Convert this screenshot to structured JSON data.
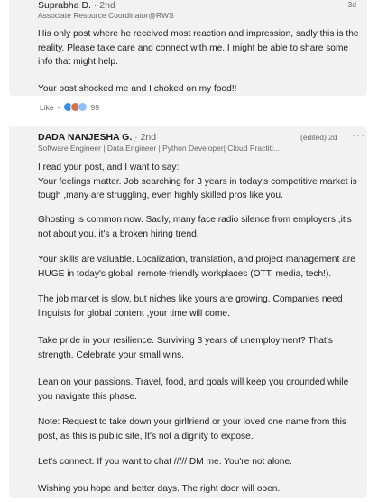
{
  "comment1": {
    "author": "Suprabha D.",
    "degree": "· 2nd",
    "subtitle": "Associate Resource Coordinator@RWS",
    "time": "3d",
    "paragraphs": [
      "His only post where he received most reaction and impression, sadly this is the reality. Please take care and connect with me. I might be able to share some info that might help.",
      "Your post shocked me and I choked on my food!!"
    ],
    "like_label": "Like",
    "reaction_count": "99"
  },
  "comment2": {
    "author": "DADA NANJESHA G.",
    "degree": "· 2nd",
    "subtitle": "Software Engineer | Data Engineer | Python Developer| Cloud Practiti...",
    "edited_time": "(edited) 2d",
    "more": "···",
    "paragraphs": [
      "I read your post, and I want to say:\nYour feelings matter. Job searching for 3 years in today's competitive market is tough ,many are struggling, even highly skilled pros like you.",
      "Ghosting is common now. Sadly, many face radio silence from employers ,it's not about you, it's a broken hiring trend.",
      "Your skills are valuable. Localization, translation, and project management are HUGE in today's global, remote-friendly workplaces (OTT, media, tech!).",
      "The job market is slow, but niches like yours are growing. Companies need linguists for global content ,your time will come.",
      "Take pride in your resilience. Surviving 3 years of unemployment? That's strength. Celebrate your small wins.",
      "Lean on your passions. Travel, food, and goals will keep you grounded while you navigate this phase.",
      "Note: Request to take down your girlfriend or your loved one name from this post, as this is public site, It's not a dignity to expose.",
      "Let's connect. If you want to chat ///// DM me. You're not alone.",
      "Wishing you hope and better days. The right door will open."
    ]
  },
  "icons": [
    "avatar",
    "like-reaction-icon",
    "love-reaction-icon",
    "support-reaction-icon",
    "more-options-icon"
  ],
  "colors": {
    "card_bg": "#f2f2f2",
    "like_blue": "#378fe9",
    "love_red": "#df704d"
  }
}
